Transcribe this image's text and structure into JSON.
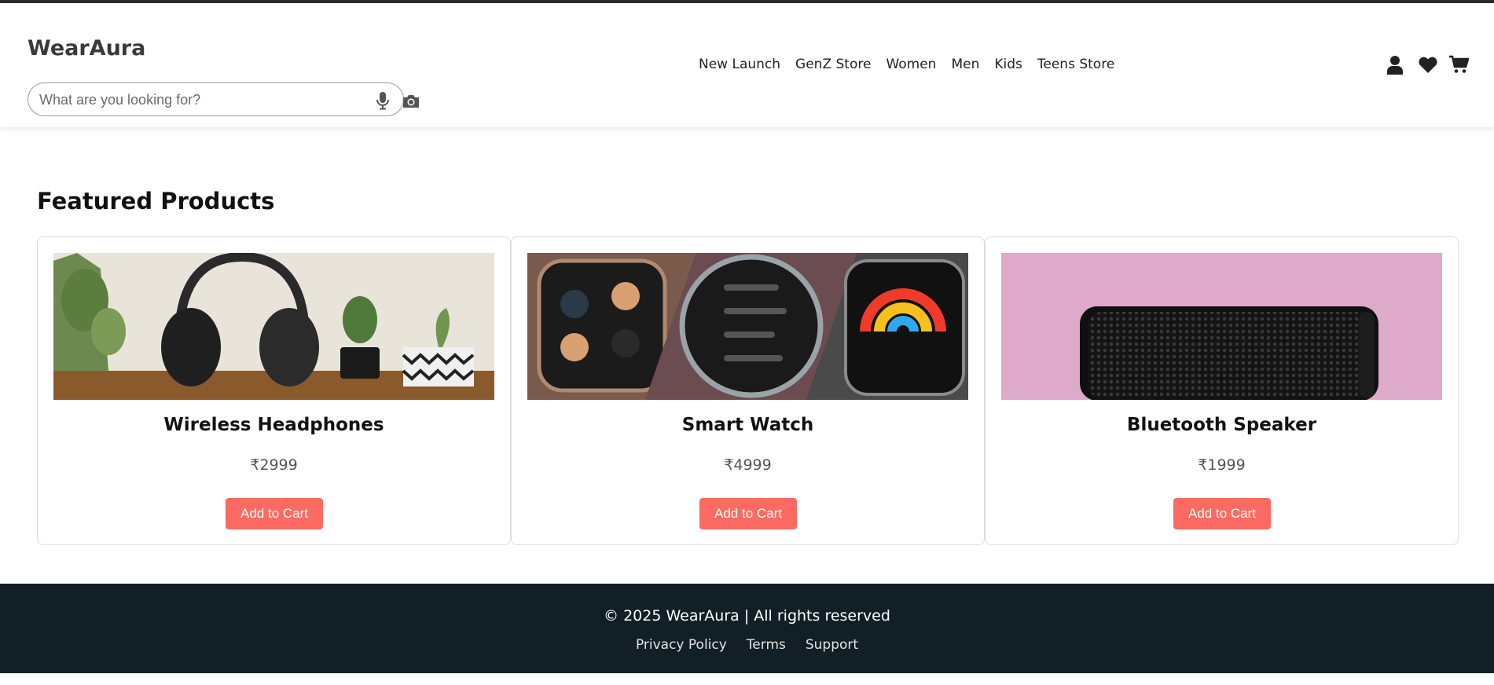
{
  "brand": {
    "name": "WearAura"
  },
  "search": {
    "placeholder": "What are you looking for?",
    "value": "",
    "mic_icon": "mic-icon",
    "camera_icon": "camera-icon"
  },
  "nav": {
    "items": [
      {
        "label": "New Launch"
      },
      {
        "label": "GenZ Store"
      },
      {
        "label": "Women"
      },
      {
        "label": "Men"
      },
      {
        "label": "Kids"
      },
      {
        "label": "Teens Store"
      }
    ],
    "icons": [
      "user-icon",
      "heart-icon",
      "cart-icon"
    ]
  },
  "featured": {
    "title": "Featured Products",
    "products": [
      {
        "name": "Wireless Headphones",
        "price": "₹2999",
        "button": "Add to Cart",
        "image": "headphones-image"
      },
      {
        "name": "Smart Watch",
        "price": "₹4999",
        "button": "Add to Cart",
        "image": "smartwatch-image"
      },
      {
        "name": "Bluetooth Speaker",
        "price": "₹1999",
        "button": "Add to Cart",
        "image": "speaker-image"
      }
    ]
  },
  "footer": {
    "copyright": "© 2025 WearAura | All rights reserved",
    "links": [
      {
        "label": "Privacy Policy"
      },
      {
        "label": "Terms"
      },
      {
        "label": "Support"
      }
    ]
  },
  "colors": {
    "accent": "#fb6b61",
    "footer_bg": "#121f26",
    "text_dark": "#111111"
  }
}
